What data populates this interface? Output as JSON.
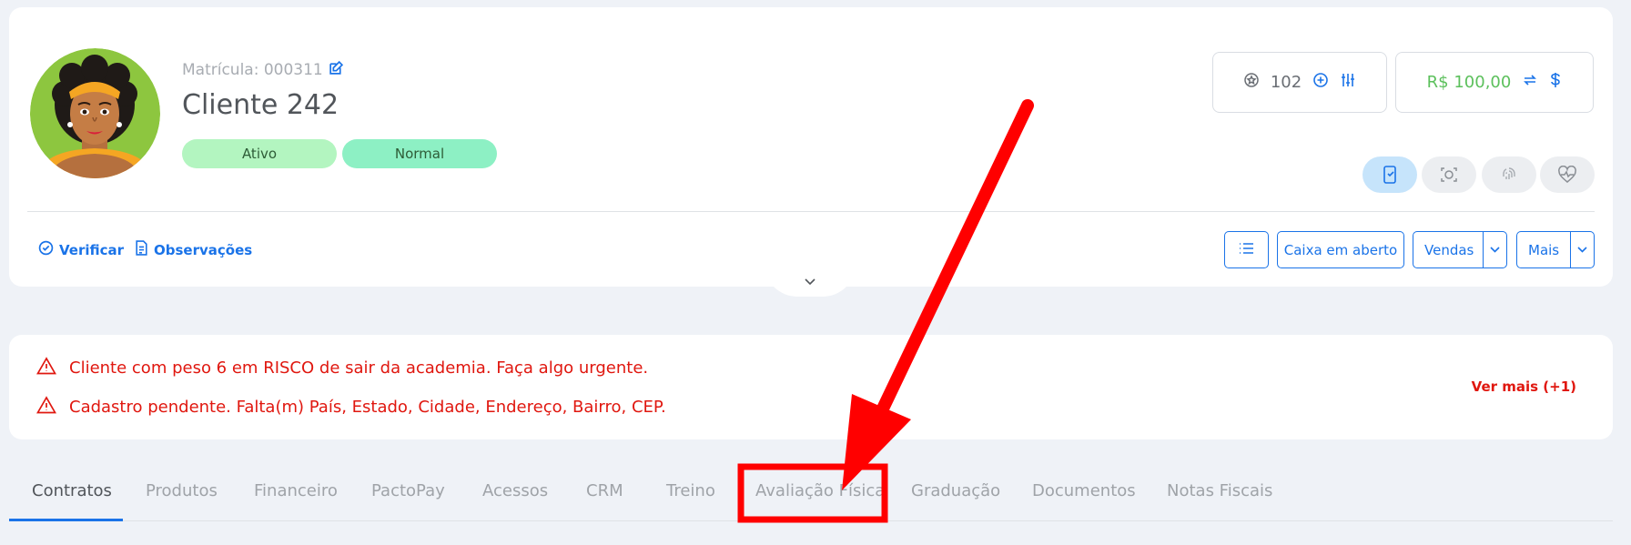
{
  "header": {
    "matricula": "Matrícula: 000311",
    "client_name": "Cliente 242",
    "badges": [
      "Ativo",
      "Normal"
    ],
    "points": "102",
    "balance": "R$ 100,00"
  },
  "actions": {
    "verificar": "Verificar",
    "observacoes": "Observações",
    "caixa": "Caixa em aberto",
    "vendas": "Vendas",
    "mais": "Mais"
  },
  "alerts": {
    "items": [
      "Cliente com peso 6 em RISCO de sair da academia. Faça algo urgente.",
      "Cadastro pendente. Falta(m) País, Estado, Cidade, Endereço, Bairro, CEP."
    ],
    "see_more": "Ver mais (+1)"
  },
  "tabs": [
    "Contratos",
    "Produtos",
    "Financeiro",
    "PactoPay",
    "Acessos",
    "CRM",
    "Treino",
    "Avaliação Física",
    "Graduação",
    "Documentos",
    "Notas Fiscais"
  ],
  "active_tab": "Contratos",
  "highlighted_tab": "Avaliação Física",
  "colors": {
    "accent": "#1a73e8",
    "alert": "#e0170f",
    "annotation": "#ff0000",
    "badge_ativo": "#b3f5c0",
    "badge_normal": "#8df0c4",
    "balance": "#5cc05c"
  }
}
